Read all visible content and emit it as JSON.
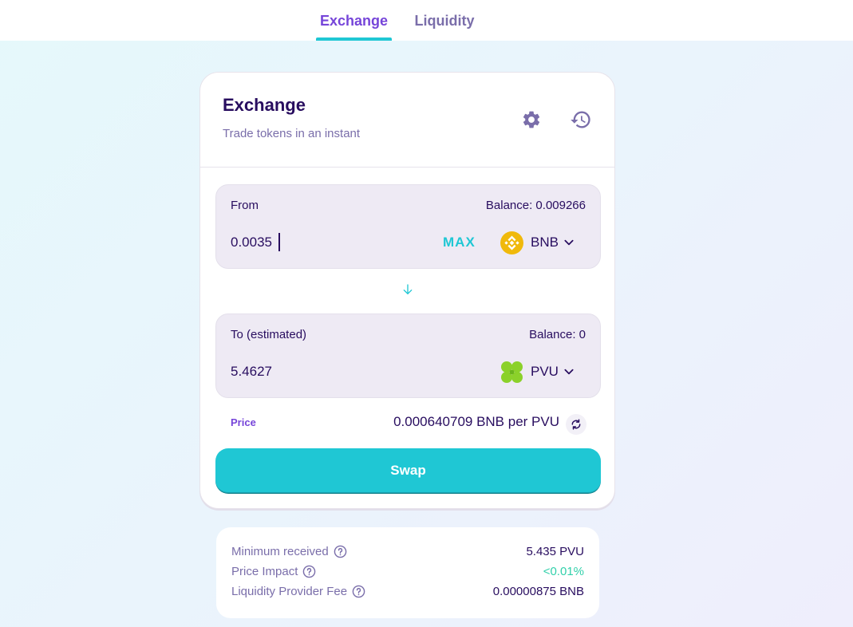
{
  "tabs": [
    {
      "label": "Exchange",
      "active": true
    },
    {
      "label": "Liquidity",
      "active": false
    }
  ],
  "card": {
    "title": "Exchange",
    "subtitle": "Trade tokens in an instant",
    "settings_icon": "gear-icon",
    "history_icon": "history-icon"
  },
  "from": {
    "label": "From",
    "balance": "Balance: 0.009266",
    "amount": "0.0035",
    "max_label": "MAX",
    "token": "BNB",
    "token_color": "#f0b90b"
  },
  "to": {
    "label": "To (estimated)",
    "balance": "Balance: 0",
    "amount": "5.4627",
    "token": "PVU",
    "token_color": "#8bd12a"
  },
  "price": {
    "label": "Price",
    "value": "0.000640709 BNB per PVU"
  },
  "swap_label": "Swap",
  "details": {
    "minimum_received_label": "Minimum received",
    "minimum_received_value": "5.435 PVU",
    "price_impact_label": "Price Impact",
    "price_impact_value": "<0.01%",
    "lp_fee_label": "Liquidity Provider Fee",
    "lp_fee_value": "0.00000875 BNB"
  },
  "colors": {
    "accent": "#1fc7d4",
    "primary_text": "#280d5f",
    "secondary_text": "#7a6eaa",
    "purple": "#7645d9",
    "success": "#31d0aa"
  }
}
